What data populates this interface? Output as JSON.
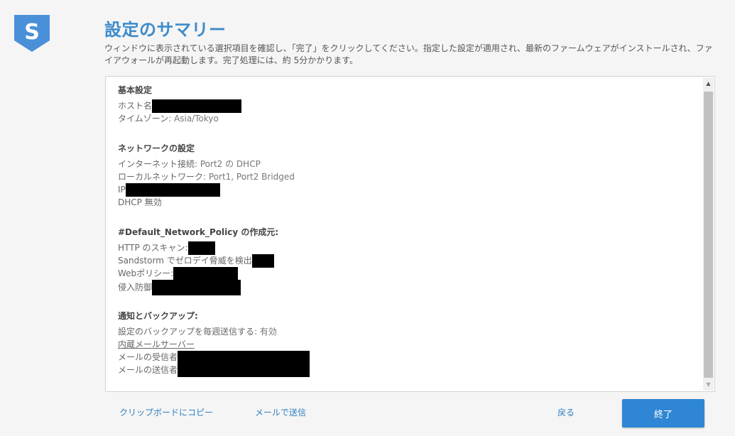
{
  "brand": {
    "logo_letter": "S",
    "color": "#4a90d9"
  },
  "header": {
    "title": "設定のサマリー",
    "description": "ウィンドウに表示されている選択項目を確認し、「完了」をクリックしてください。指定した設定が適用され、最新のファームウェアがインストールされ、ファイアウォールが再起動します。完了処理には、約 5分かかります。"
  },
  "summary": {
    "basic": {
      "title": "基本設定",
      "hostname_label": "ホスト名",
      "timezone_label": "タイムゾーン",
      "timezone_value": ": Asia/Tokyo"
    },
    "network": {
      "title": "ネットワークの設定",
      "internet_label": "インターネット接続",
      "internet_value": ": Port2 の DHCP",
      "local_label": "ローカルネットワーク",
      "local_value": ": Port1, Port2 Bridged",
      "ip_label": "IP",
      "dhcp_label": "DHCP 無効"
    },
    "policy": {
      "title": "#Default_Network_Policy の作成元:",
      "http_label": "HTTP のスキャン:",
      "sandstorm_label": "Sandstorm でゼロデイ脅威を検出",
      "web_label": "Webポリシー:",
      "ips_label": "侵入防御"
    },
    "notify": {
      "title": "通知とバックアップ:",
      "backup_label": "設定のバックアップを毎週送信する",
      "backup_value": ": 有効",
      "mailserver_label": "内蔵メールサーバー",
      "recipient_label": "メールの受信者",
      "sender_label": "メールの送信者"
    }
  },
  "footer": {
    "copy_label": "クリップボードにコピー",
    "email_label": "メールで送信",
    "back_label": "戻る",
    "finish_label": "終了"
  },
  "colors": {
    "accent": "#3d8ccb",
    "button": "#2f86d4",
    "link": "#2f7fc1"
  }
}
